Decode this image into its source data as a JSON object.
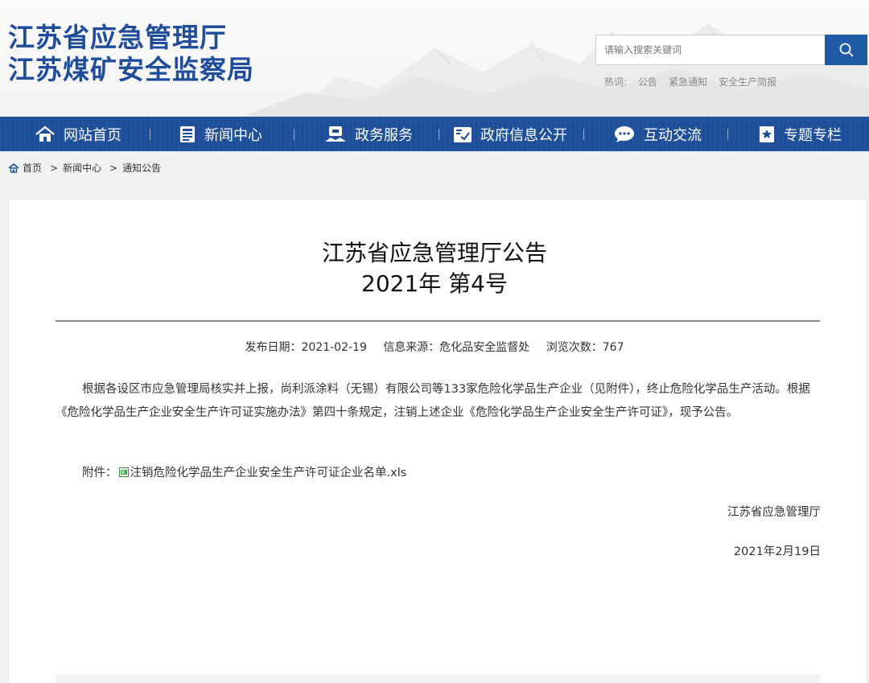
{
  "header": {
    "title_line1": "江苏省应急管理厅",
    "title_line2": "江苏煤矿安全监察局",
    "brand_color": "#1f4d9b"
  },
  "search": {
    "placeholder": "请输入搜索关键词",
    "button_icon": "search-icon"
  },
  "hot_words": {
    "label": "热词:",
    "items": [
      "公告",
      "紧急通知",
      "安全生产简报"
    ]
  },
  "nav": {
    "background": "#1e4f99",
    "items": [
      {
        "label": "网站首页",
        "icon": "home-icon"
      },
      {
        "label": "新闻中心",
        "icon": "newspaper-icon"
      },
      {
        "label": "政务服务",
        "icon": "service-icon"
      },
      {
        "label": "政府信息公开",
        "icon": "document-check-icon"
      },
      {
        "label": "互动交流",
        "icon": "chat-icon"
      },
      {
        "label": "专题专栏",
        "icon": "bookmark-icon"
      }
    ]
  },
  "breadcrumb": {
    "icon": "home-icon",
    "items": [
      "首页",
      "新闻中心",
      "通知公告"
    ],
    "separator": ">"
  },
  "article": {
    "title_line1": "江苏省应急管理厅公告",
    "title_line2": "2021年 第4号",
    "meta": {
      "date_label": "发布日期：2021-02-19",
      "source_label": "信息来源：危化品安全监督处",
      "views_label": "浏览次数：767"
    },
    "body": "根据各设区市应急管理局核实并上报，尚利派涂料（无锡）有限公司等133家危险化学品生产企业（见附件），终止危险化学品生产活动。根据《危险化学品生产企业安全生产许可证实施办法》第四十条规定，注销上述企业《危险化学品生产企业安全生产许可证》，现予公告。",
    "attachment_label": "附件：",
    "attachment_icon": "xls-file-icon",
    "attachment_name": "注销危险化学品生产企业安全生产许可证企业名单.xls",
    "signature_org": "江苏省应急管理厅",
    "signature_date": "2021年2月19日"
  }
}
